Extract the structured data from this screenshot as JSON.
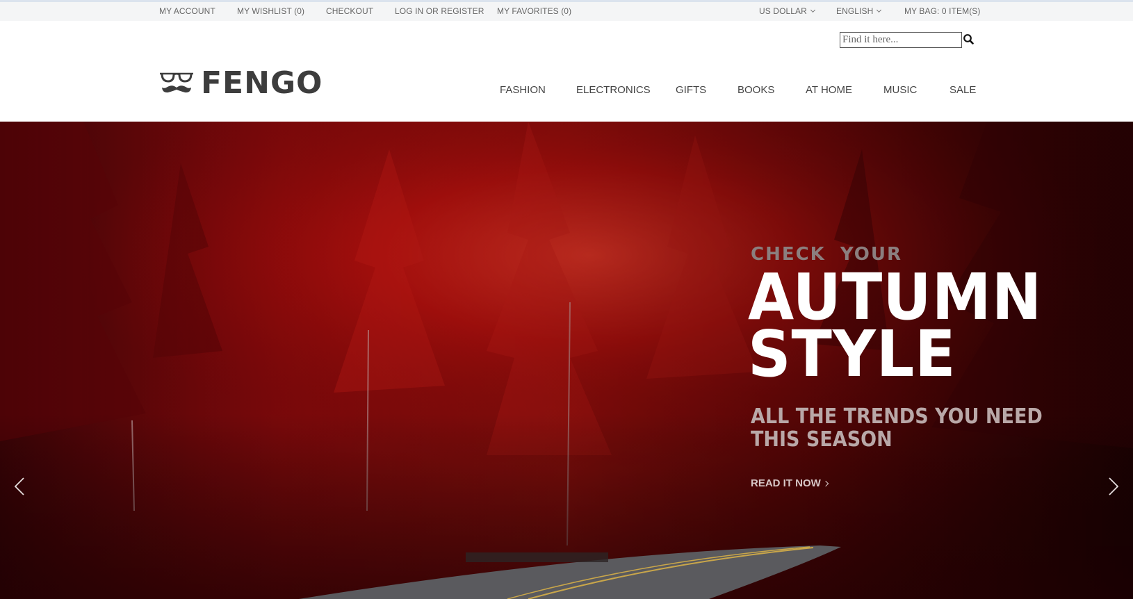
{
  "topbar": {
    "my_account": "MY ACCOUNT",
    "my_wishlist": "MY WISHLIST (0)",
    "checkout": "CHECKOUT",
    "login_register": "LOG IN OR REGISTER",
    "my_favorites": "MY FAVORITES (0)",
    "currency": "US DOLLAR",
    "language": "ENGLISH",
    "my_bag": "MY BAG: 0 ITEM(S)"
  },
  "search": {
    "placeholder": "Find it here..."
  },
  "logo": {
    "text": "FENGO"
  },
  "nav": {
    "items": [
      "FASHION",
      "ELECTRONICS",
      "GIFTS",
      "BOOKS",
      "AT HOME",
      "MUSIC",
      "SALE"
    ]
  },
  "hero": {
    "eyebrow": "CHECK  YOUR",
    "title_line1": "AUTUMN",
    "title_line2": "STYLE",
    "subtitle_line1": "ALL THE TRENDS YOU NEED",
    "subtitle_line2": "THIS SEASON",
    "cta": "READ IT NOW"
  },
  "colors": {
    "accent_red": "#b3060d",
    "text_dark": "#3d3d3d",
    "topbar_bg": "#f4f5f6"
  }
}
